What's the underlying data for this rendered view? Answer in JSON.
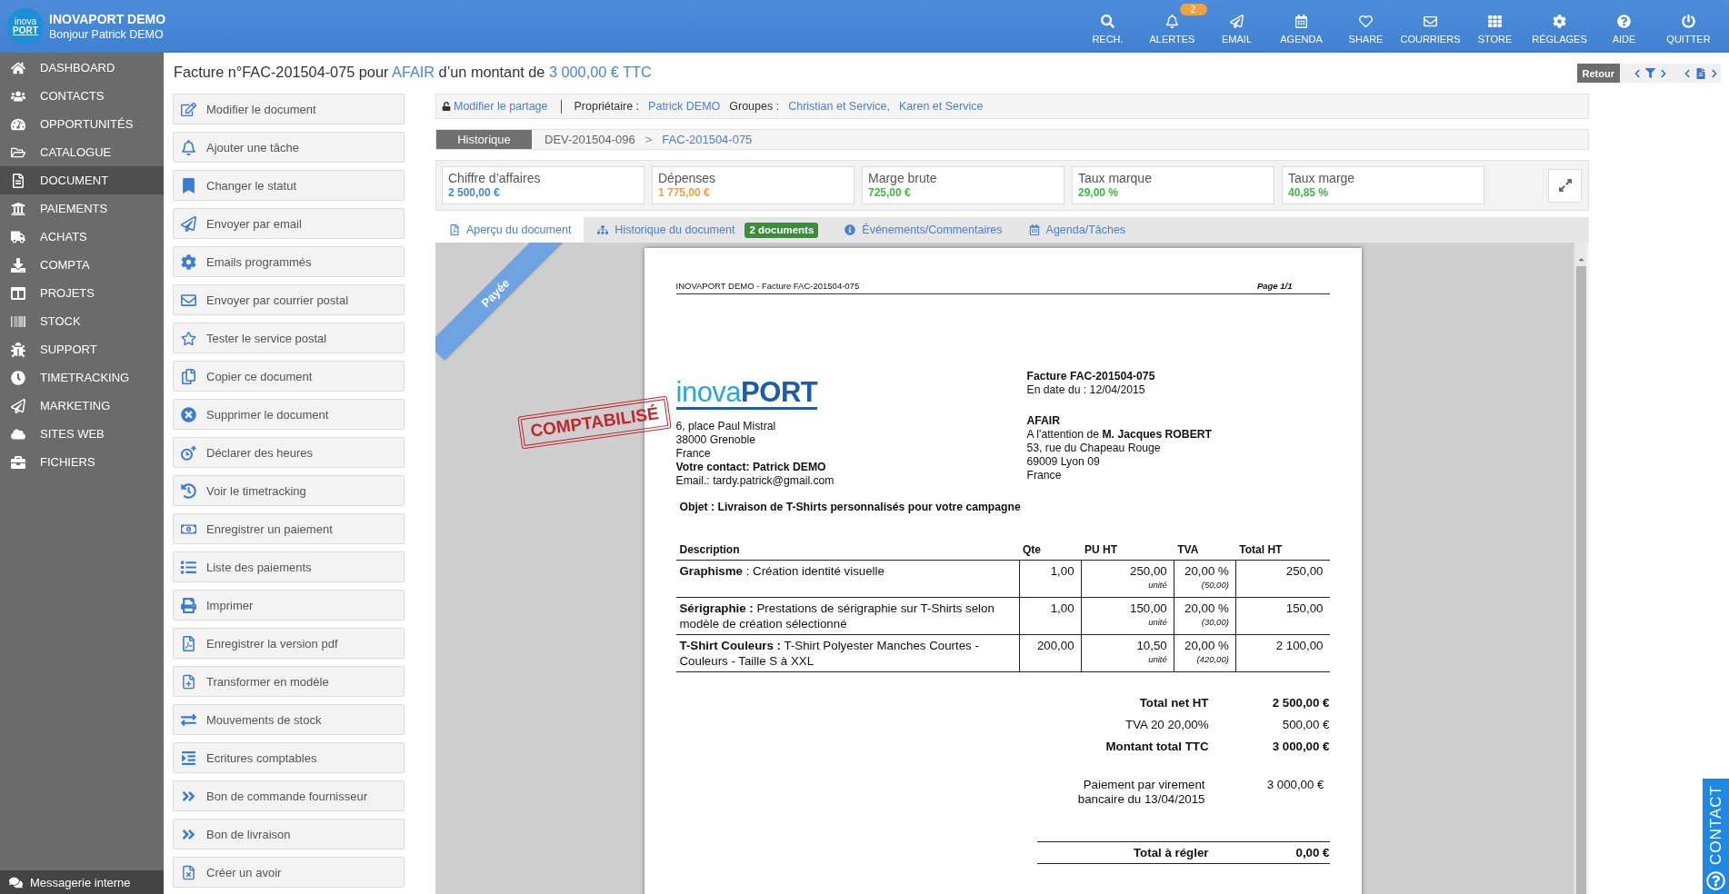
{
  "header": {
    "logo_lines": [
      "inova",
      "PORT"
    ],
    "title": "INOVAPORT DEMO",
    "greeting": "Bonjour Patrick DEMO",
    "nav": [
      {
        "label": "RECH."
      },
      {
        "label": "ALERTES",
        "badge": "2"
      },
      {
        "label": "EMAIL"
      },
      {
        "label": "AGENDA"
      },
      {
        "label": "SHARE"
      },
      {
        "label": "COURRIERS"
      },
      {
        "label": "STORE"
      },
      {
        "label": "RÉGLAGES"
      },
      {
        "label": "AIDE"
      },
      {
        "label": "QUITTER"
      }
    ]
  },
  "sidebar": {
    "items": [
      {
        "label": "DASHBOARD",
        "selected": false
      },
      {
        "label": "CONTACTS",
        "selected": false
      },
      {
        "label": "OPPORTUNITÉS",
        "selected": false
      },
      {
        "label": "CATALOGUE",
        "selected": false
      },
      {
        "label": "DOCUMENT",
        "selected": true
      },
      {
        "label": "PAIEMENTS",
        "selected": false
      },
      {
        "label": "ACHATS",
        "selected": false
      },
      {
        "label": "COMPTA",
        "selected": false
      },
      {
        "label": "PROJETS",
        "selected": false
      },
      {
        "label": "STOCK",
        "selected": false
      },
      {
        "label": "SUPPORT",
        "selected": false
      },
      {
        "label": "TIMETRACKING",
        "selected": false
      },
      {
        "label": "MARKETING",
        "selected": false
      },
      {
        "label": "SITES WEB",
        "selected": false
      },
      {
        "label": "FICHIERS",
        "selected": false
      }
    ],
    "footer": "Messagerie interne"
  },
  "page_title": {
    "text": "Facture n°FAC-201504-075 pour",
    "client": "AFAIR",
    "amount_text": "d’un montant de",
    "amount": "3 000,00 € TTC"
  },
  "top_controls": {
    "back": "Retour"
  },
  "actions": [
    "Modifier le document",
    "Ajouter une tâche",
    "Changer le statut",
    "Envoyer par email",
    "Emails programmés",
    "Envoyer par courrier postal",
    "Tester le service postal",
    "Copier ce document",
    "Supprimer le document",
    "Déclarer des heures",
    "Voir le timetracking",
    "Enregistrer un paiement",
    "Liste des paiements",
    "Imprimer",
    "Enregistrer la version pdf",
    "Transformer en modèle",
    "Mouvements de stock",
    "Ecritures comptables",
    "Bon de commande fournisseur",
    "Bon de livraison",
    "Créer un avoir"
  ],
  "share_bar": {
    "edit_link": "Modifier le partage",
    "owner_label": "Propriétaire :",
    "owner": "Patrick DEMO",
    "groups_label": "Groupes :",
    "groups": [
      "Christian et Service,",
      "Karen et Service"
    ]
  },
  "history_bar": {
    "tab": "Historique",
    "separator": ">",
    "trail": [
      {
        "label": "DEV-201504-096",
        "selected": false
      },
      {
        "label": "FAC-201504-075",
        "selected": true
      }
    ]
  },
  "kpis": [
    {
      "label": "Chiffre d’affaires",
      "value": "2 500,00 €",
      "color": "#4a86d4"
    },
    {
      "label": "Dépenses",
      "value": "1 775,00 €",
      "color": "#f0a040"
    },
    {
      "label": "Marge brute",
      "value": "725,00 €",
      "color": "#3fb94a"
    },
    {
      "label": "Taux marque",
      "value": "29,00 %",
      "color": "#3fb94a"
    },
    {
      "label": "Taux marge",
      "value": "40,85 %",
      "color": "#3fb94a"
    }
  ],
  "tabs": [
    {
      "label": "Aperçu du document",
      "selected": true
    },
    {
      "label": "Historique du document",
      "badge": "2 documents",
      "selected": false
    },
    {
      "label": "Événements/Commentaires",
      "selected": false
    },
    {
      "label": "Agenda/Tâches",
      "selected": false
    }
  ],
  "preview": {
    "ribbon": "Payée",
    "stamp": "COMPTABILISÉ",
    "document": {
      "running_header": "INOVAPORT DEMO - Facture FAC-201504-075",
      "page": "Page 1/1",
      "logo": "inova**PORT**",
      "sender": {
        "address": [
          "6, place Paul Mistral",
          "38000 Grenoble",
          "France"
        ],
        "contact": "Votre contact: Patrick DEMO",
        "email": "Email.: tardy.patrick@gmail.com"
      },
      "invoice_ref": "Facture FAC-201504-075",
      "date": "En date du : 12/04/2015",
      "recipient": {
        "name": "AFAIR",
        "attention": "A l'attention de **M. Jacques ROBERT**",
        "address": [
          "53, rue du Chapeau Rouge",
          "69009 Lyon 09",
          "France"
        ]
      },
      "subject": "Objet : Livraison de T-Shirts personnalisés pour votre campagne",
      "table": {
        "columns": [
          "Description",
          "Qte",
          "PU HT",
          "TVA",
          "Total HT"
        ],
        "rows": [
          {
            "description": "**Graphisme** : Création identité visuelle",
            "qty": "1,00",
            "unit_price": "250,00",
            "unit": "unité",
            "vat": "20,00 %",
            "vat_amount": "(50,00)",
            "total": "250,00"
          },
          {
            "description": "**Sérigraphie :** Prestations de sérigraphie sur T-Shirts selon modèle de création sélectionné",
            "qty": "1,00",
            "unit_price": "150,00",
            "unit": "unité",
            "vat": "20,00 %",
            "vat_amount": "(30,00)",
            "total": "150,00"
          },
          {
            "description": "**T-Shirt Couleurs :** T-Shirt Polyester Manches Courtes - Couleurs - Taille S à XXL",
            "qty": "200,00",
            "unit_price": "10,50",
            "unit": "unité",
            "vat": "20,00 %",
            "vat_amount": "(420,00)",
            "total": "2 100,00"
          }
        ]
      },
      "totals": [
        {
          "label": "Total net HT",
          "value": "2 500,00 €",
          "kind": "strong"
        },
        {
          "label": "TVA 20 20,00%",
          "value": "500,00 €",
          "kind": "plain"
        },
        {
          "label": "Montant total TTC",
          "value": "3 000,00 €",
          "kind": "strong"
        }
      ],
      "payments": [
        {
          "label": "Paiement par virement bancaire du 13/04/2015",
          "value": "3 000,00 €"
        }
      ],
      "balance": {
        "label": "Total à régler",
        "value": "0,00 €"
      }
    }
  },
  "contact_tab": "CONTACT"
}
